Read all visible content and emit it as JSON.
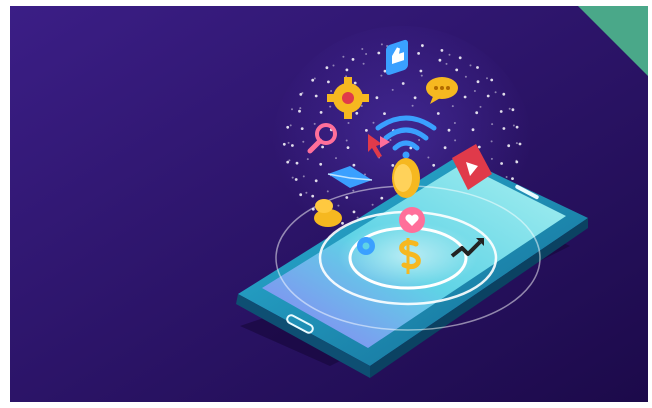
{
  "scene": {
    "subject": "smartphone-with-floating-app-icons",
    "colors": {
      "page_background": "#ffffff",
      "background_dark": "#2a1060",
      "background_mid": "#3b1e86",
      "phone_body": "#1f8fb8",
      "phone_screen": "#5fd3e6",
      "corner_accent": "#4aa889",
      "icon_yellow": "#f6b820",
      "icon_blue": "#3aa0ff",
      "icon_red": "#e03a4a",
      "icon_pink": "#ff6f9a",
      "glow_white": "#ffffff"
    },
    "icons": [
      "like-thumb-icon",
      "chat-bubble-icon",
      "gear-icon",
      "wifi-icon",
      "magnifier-icon",
      "map-pin-icon",
      "video-play-icon",
      "heart-icon",
      "dollar-icon",
      "trend-arrow-icon",
      "mail-icon",
      "cursor-icon",
      "coin-icon"
    ]
  }
}
